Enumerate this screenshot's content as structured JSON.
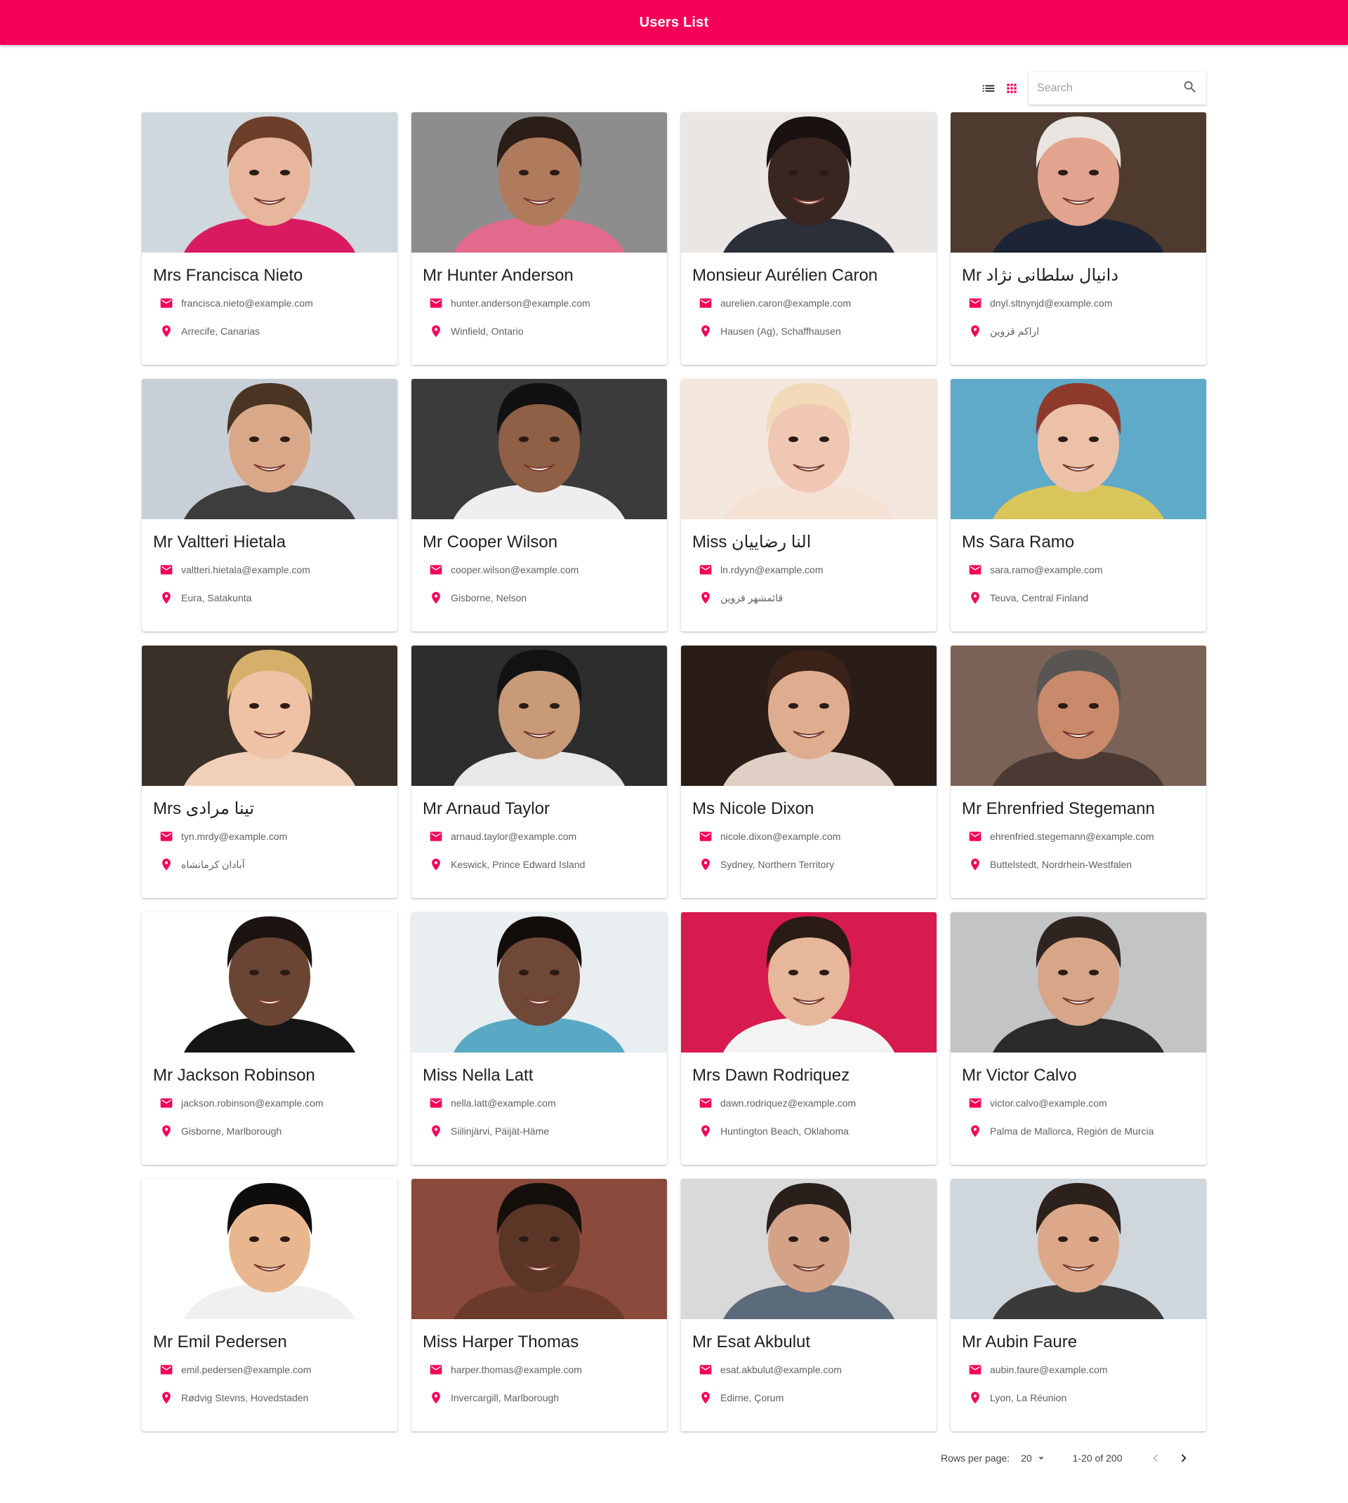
{
  "header": {
    "title": "Users List"
  },
  "toolbar": {
    "list_view_icon": "list-view-icon",
    "grid_view_icon": "grid-view-icon",
    "search_placeholder": "Search",
    "search_icon": "search-icon"
  },
  "colors": {
    "accent": "#f50057",
    "icon_muted": "#424242"
  },
  "users": [
    {
      "name": "Mrs Francisca Nieto",
      "email": "francisca.nieto@example.com",
      "location": "Arrecife, Canarias",
      "photo": {
        "bg": "#cfd8dc",
        "skin": "#e7b69c",
        "hair": "#6b3f2a",
        "shirt": "#d81b60"
      }
    },
    {
      "name": "Mr Hunter Anderson",
      "email": "hunter.anderson@example.com",
      "location": "Winfield, Ontario",
      "photo": {
        "bg": "#8d8d8d",
        "skin": "#b07b5c",
        "hair": "#2b1d17",
        "shirt": "#e26a8c"
      }
    },
    {
      "name": "Monsieur Aurélien Caron",
      "email": "aurelien.caron@example.com",
      "location": "Hausen (Ag), Schaffhausen",
      "photo": {
        "bg": "#e9e6e4",
        "skin": "#3a2620",
        "hair": "#1a1210",
        "shirt": "#2b2f3a"
      }
    },
    {
      "name": "Mr دانیال سلطانی نژاد",
      "email": "dnyl.sltnynjd@example.com",
      "location": "اراکم قزوین",
      "photo": {
        "bg": "#4e3a2e",
        "skin": "#e2a48e",
        "hair": "#e8e4df",
        "shirt": "#1c2436"
      }
    },
    {
      "name": "Mr Valtteri Hietala",
      "email": "valtteri.hietala@example.com",
      "location": "Eura, Satakunta",
      "photo": {
        "bg": "#c9cfd6",
        "skin": "#d9a889",
        "hair": "#4a3424",
        "shirt": "#3d3d3d"
      }
    },
    {
      "name": "Mr Cooper Wilson",
      "email": "cooper.wilson@example.com",
      "location": "Gisborne, Nelson",
      "photo": {
        "bg": "#3b3b3b",
        "skin": "#8f6045",
        "hair": "#111111",
        "shirt": "#eeeeee"
      }
    },
    {
      "name": "Miss النا رضاییان",
      "email": "ln.rdyyn@example.com",
      "location": "قائمشهر قزوین",
      "photo": {
        "bg": "#f3e6dd",
        "skin": "#f0c7b3",
        "hair": "#f2d9b8",
        "shirt": "#f5e2d5"
      }
    },
    {
      "name": "Ms Sara Ramo",
      "email": "sara.ramo@example.com",
      "location": "Teuva, Central Finland",
      "photo": {
        "bg": "#5fa9c9",
        "skin": "#edc1a8",
        "hair": "#8e3a2a",
        "shirt": "#d9c65a"
      }
    },
    {
      "name": "Mrs تینا مرادی",
      "email": "tyn.mrdy@example.com",
      "location": "آبادان کرمانشاه",
      "photo": {
        "bg": "#3a3028",
        "skin": "#efc2a5",
        "hair": "#d6b06a",
        "shirt": "#f0d0b8"
      }
    },
    {
      "name": "Mr Arnaud Taylor",
      "email": "arnaud.taylor@example.com",
      "location": "Keswick, Prince Edward Island",
      "photo": {
        "bg": "#2d2d2d",
        "skin": "#c99a78",
        "hair": "#121212",
        "shirt": "#e8e8e8"
      }
    },
    {
      "name": "Ms Nicole Dixon",
      "email": "nicole.dixon@example.com",
      "location": "Sydney, Northern Territory",
      "photo": {
        "bg": "#2a1d18",
        "skin": "#deac8f",
        "hair": "#3a2219",
        "shirt": "#e0cfc5"
      }
    },
    {
      "name": "Mr Ehrenfried Stegemann",
      "email": "ehrenfried.stegemann@example.com",
      "location": "Buttelstedt, Nordrhein-Westfalen",
      "photo": {
        "bg": "#7a6356",
        "skin": "#c9896b",
        "hair": "#595552",
        "shirt": "#4a3a33"
      }
    },
    {
      "name": "Mr Jackson Robinson",
      "email": "jackson.robinson@example.com",
      "location": "Gisborne, Marlborough",
      "photo": {
        "bg": "#ffffff",
        "skin": "#6a4533",
        "hair": "#1c1410",
        "shirt": "#151515"
      }
    },
    {
      "name": "Miss Nella Latt",
      "email": "nella.latt@example.com",
      "location": "Siilinjärvi, Päijät-Häme",
      "photo": {
        "bg": "#e9eef0",
        "skin": "#6f4837",
        "hair": "#120d0b",
        "shirt": "#5aa9c4"
      }
    },
    {
      "name": "Mrs Dawn Rodriquez",
      "email": "dawn.rodriquez@example.com",
      "location": "Huntington Beach, Oklahoma",
      "photo": {
        "bg": "#d81b4f",
        "skin": "#e7b79b",
        "hair": "#2a1a14",
        "shirt": "#f3f3f3"
      }
    },
    {
      "name": "Mr Victor Calvo",
      "email": "victor.calvo@example.com",
      "location": "Palma de Mallorca, Región de Murcia",
      "photo": {
        "bg": "#c3c4c6",
        "skin": "#d7a588",
        "hair": "#2e2520",
        "shirt": "#2b2b2b"
      }
    },
    {
      "name": "Mr Emil Pedersen",
      "email": "emil.pedersen@example.com",
      "location": "Rødvig Stevns, Hovedstaden",
      "photo": {
        "bg": "#ffffff",
        "skin": "#e9b78f",
        "hair": "#0f0d0c",
        "shirt": "#f0f0f0"
      }
    },
    {
      "name": "Miss Harper Thomas",
      "email": "harper.thomas@example.com",
      "location": "Invercargill, Marlborough",
      "photo": {
        "bg": "#8a4b3c",
        "skin": "#5b3627",
        "hair": "#150f0c",
        "shirt": "#6b3a2b"
      }
    },
    {
      "name": "Mr Esat Akbulut",
      "email": "esat.akbulut@example.com",
      "location": "Edirne, Çorum",
      "photo": {
        "bg": "#d9d9d9",
        "skin": "#d4a286",
        "hair": "#2a201b",
        "shirt": "#5b6b7b"
      }
    },
    {
      "name": "Mr Aubin Faure",
      "email": "aubin.faure@example.com",
      "location": "Lyon, La Réunion",
      "photo": {
        "bg": "#cfd6dc",
        "skin": "#dca889",
        "hair": "#2c211b",
        "shirt": "#3a3a3a"
      }
    }
  ],
  "pagination": {
    "rows_label": "Rows per page:",
    "rows_value": "20",
    "range": "1-20 of 200",
    "prev_icon": "chevron-left-icon",
    "next_icon": "chevron-right-icon"
  }
}
